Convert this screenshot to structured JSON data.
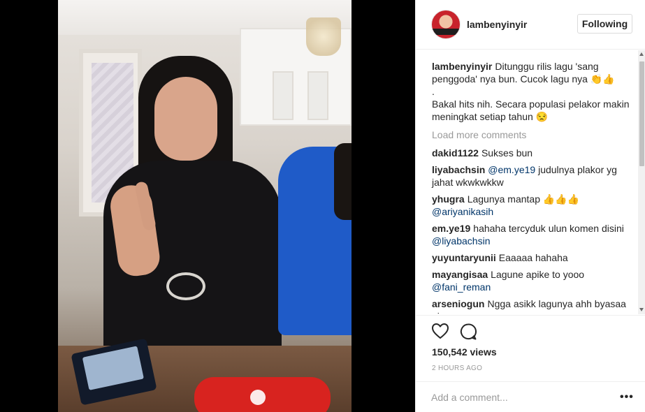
{
  "header": {
    "username": "lambenyinyir",
    "follow_label": "Following"
  },
  "caption": {
    "username": "lambenyinyir",
    "line1": "Ditunggu rilis lagu 'sang penggoda' nya bun. Cucok lagu nya 👏👍",
    "line2": ".",
    "line3": "Bakal hits nih. Secara populasi pelakor makin meningkat setiap tahun 😒"
  },
  "load_more": "Load more comments",
  "comments": [
    {
      "user": "dakid1122",
      "text": "Sukses bun",
      "mention": ""
    },
    {
      "user": "liyabachsin",
      "mention": "@em.ye19",
      "text": "judulnya plakor yg jahat wkwkwkkw"
    },
    {
      "user": "yhugra",
      "text": "Lagunya mantap 👍👍👍",
      "mention": "@ariyanikasih"
    },
    {
      "user": "em.ye19",
      "text": "hahaha tercyduk ulun komen disini",
      "mention": "@liyabachsin"
    },
    {
      "user": "yuyuntaryunii",
      "text": "Eaaaaa hahaha",
      "mention": ""
    },
    {
      "user": "mayangisaa",
      "text": "Lagune apike to yooo",
      "mention": "@fani_reman"
    },
    {
      "user": "arseniogun",
      "text": "Ngga asikk lagunya ahh byasaa aj",
      "mention": ""
    }
  ],
  "stats": {
    "views": "150,542 views",
    "time_ago": "2 HOURS AGO"
  },
  "add_comment": {
    "placeholder": "Add a comment...",
    "more_label": "•••"
  },
  "icons": {
    "like": "heart-icon",
    "comment": "comment-bubble-icon",
    "more": "more-options-icon"
  }
}
